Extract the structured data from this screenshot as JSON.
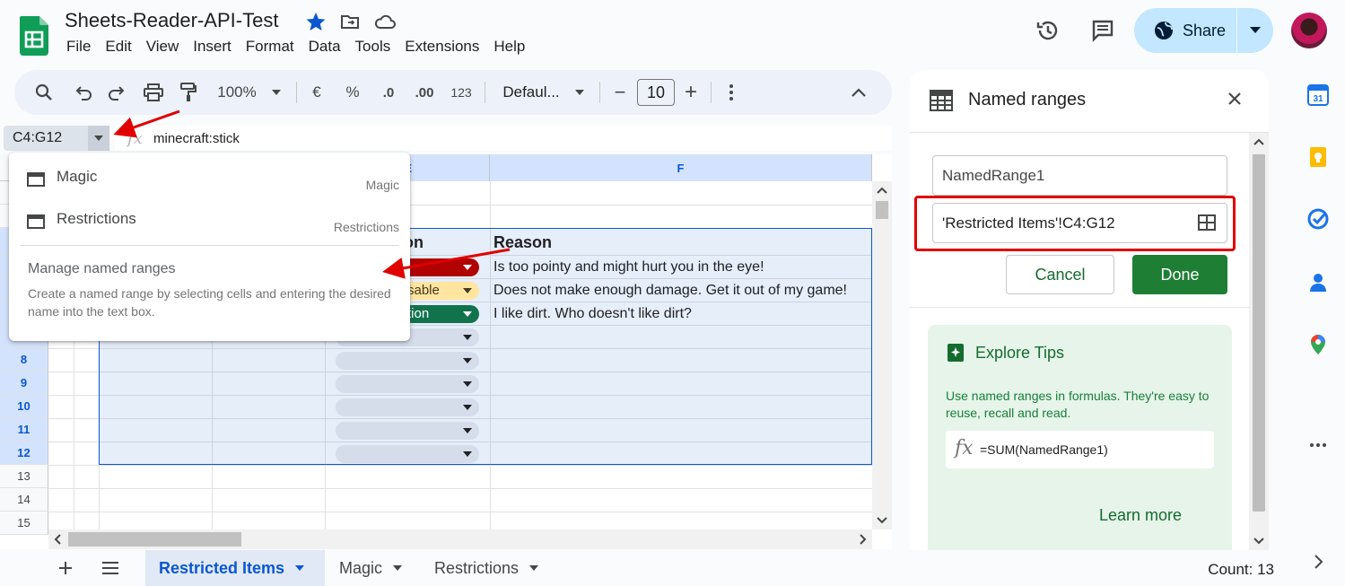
{
  "doc": {
    "title": "Sheets-Reader-API-Test"
  },
  "menu": [
    "File",
    "Edit",
    "View",
    "Insert",
    "Format",
    "Data",
    "Tools",
    "Extensions",
    "Help"
  ],
  "share": {
    "label": "Share"
  },
  "toolbar": {
    "zoom": "100%",
    "currency": "€",
    "percent": "%",
    "dec_decrease": ".0",
    "dec_increase": ".00",
    "number_format": "123",
    "font": "Defaul...",
    "font_size": "10",
    "minus": "−",
    "plus": "+"
  },
  "namebox": {
    "value": "C4:G12"
  },
  "formula": {
    "fx": "fx",
    "value": "minecraft:stick"
  },
  "grid": {
    "columns": [
      "E",
      "F"
    ],
    "rows": [
      "8",
      "9",
      "10",
      "11",
      "12",
      "13",
      "14",
      "15"
    ],
    "header_partial": "on",
    "header_reason": "Reason",
    "reasons": [
      "Is too pointy and might hurt you in the eye!",
      "Does not make enough damage. Get it out of my game!",
      "I like dirt. Who doesn't like dirt?"
    ],
    "chips": [
      {
        "label": "",
        "color": "#b10202",
        "text_color": "#ffffff"
      },
      {
        "label": "sable",
        "color": "#ffe5a0",
        "text_color": "#473821"
      },
      {
        "label": "tion",
        "color": "#11734b",
        "text_color": "#ffffff"
      }
    ]
  },
  "dropdown": {
    "items": [
      {
        "label": "Magic",
        "sub": "Magic"
      },
      {
        "label": "Restrictions",
        "sub": "Restrictions"
      }
    ],
    "manage_title": "Manage named ranges",
    "manage_desc": "Create a named range by selecting cells and entering the desired name into the text box."
  },
  "panel": {
    "title": "Named ranges",
    "name_value": "NamedRange1",
    "range_value": "'Restricted Items'!C4:G12",
    "cancel": "Cancel",
    "done": "Done",
    "tips_title": "Explore Tips",
    "tips_body": "Use named ranges in formulas. They're easy to reuse, recall and read.",
    "tips_fx": "fx",
    "tips_formula": "=SUM(NamedRange1)",
    "learn_more": "Learn more"
  },
  "sheets": {
    "tabs": [
      "Restricted Items",
      "Magic",
      "Restrictions"
    ],
    "active": "Restricted Items"
  },
  "status": {
    "count": "Count: 13"
  },
  "colors": {
    "accent": "#0b57d0",
    "share_bg": "#c2e7ff",
    "done_bg": "#1e7e34",
    "highlight": "#e00000"
  }
}
